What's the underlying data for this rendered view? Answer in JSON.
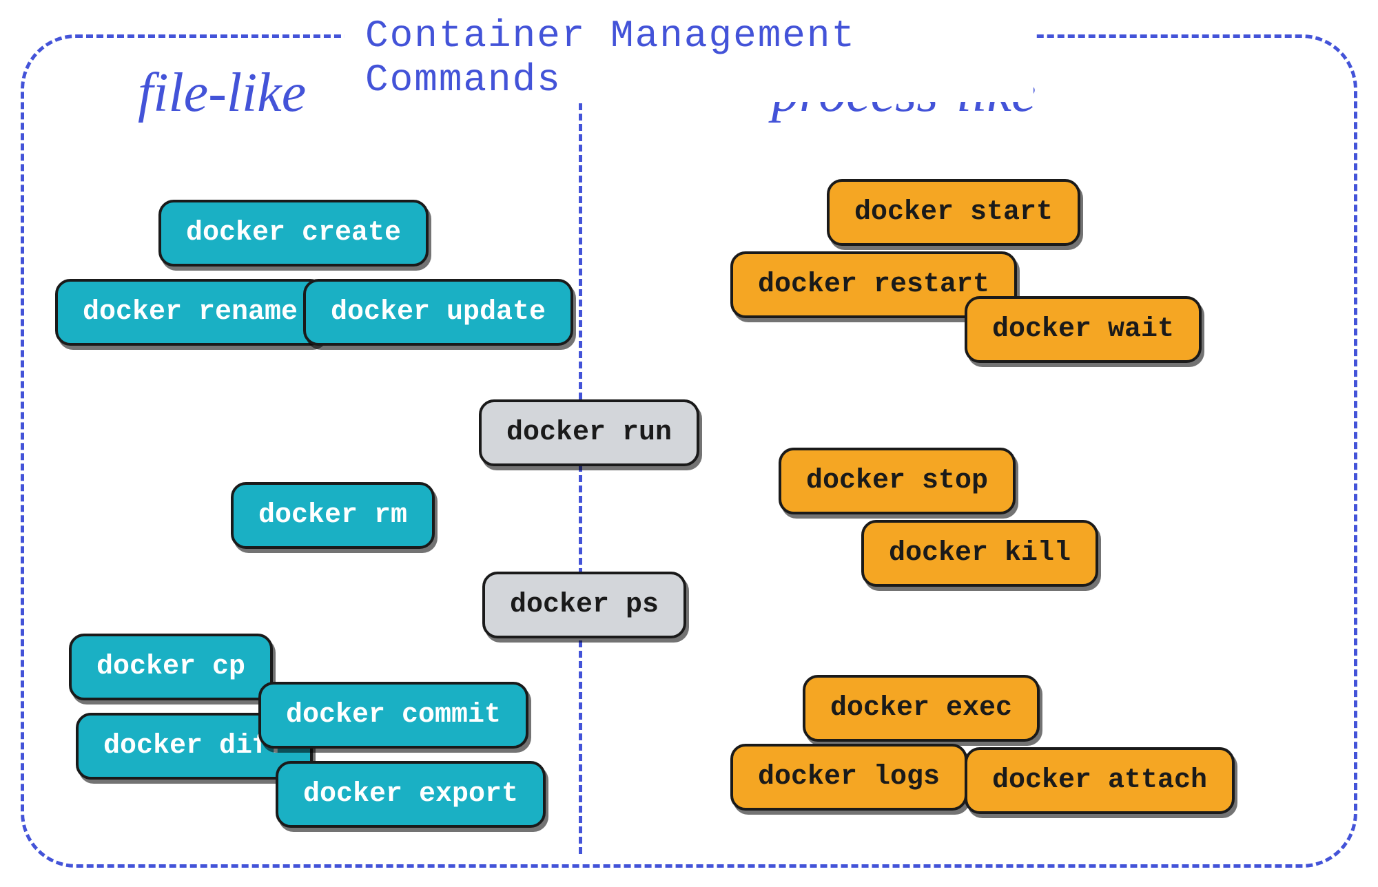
{
  "title": "Container Management Commands",
  "categories": {
    "left": "file-like",
    "right": "process-like"
  },
  "fileLike": {
    "group1": {
      "create": "docker create",
      "rename": "docker rename",
      "update": "docker update"
    },
    "rm": "docker rm",
    "group3": {
      "cp": "docker cp",
      "diff": "docker diff",
      "commit": "docker commit",
      "export": "docker export"
    }
  },
  "center": {
    "run": "docker run",
    "ps": "docker ps"
  },
  "processLike": {
    "group1": {
      "start": "docker start",
      "restart": "docker restart",
      "wait": "docker wait"
    },
    "group2": {
      "stop": "docker stop",
      "kill": "docker kill"
    },
    "group3": {
      "exec": "docker exec",
      "logs": "docker logs",
      "attach": "docker attach"
    }
  },
  "colors": {
    "fileLike": "#1ab0c4",
    "processLike": "#f5a623",
    "center": "#d3d6da",
    "border": "#4353d8"
  }
}
